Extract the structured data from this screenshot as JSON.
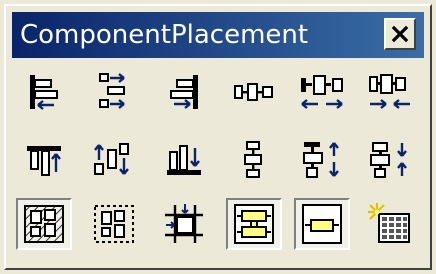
{
  "window": {
    "title": "ComponentPlacement"
  },
  "toolbar": {
    "close_icon": "close-icon",
    "rows": [
      [
        {
          "name": "align-left-icon"
        },
        {
          "name": "align-horizontal-center-icon"
        },
        {
          "name": "align-right-icon"
        },
        {
          "name": "space-equally-horizontal-icon"
        },
        {
          "name": "increase-horizontal-spacing-icon"
        },
        {
          "name": "decrease-horizontal-spacing-icon"
        }
      ],
      [
        {
          "name": "align-top-icon"
        },
        {
          "name": "align-vertical-center-icon"
        },
        {
          "name": "align-bottom-icon"
        },
        {
          "name": "space-equally-vertical-icon"
        },
        {
          "name": "increase-vertical-spacing-icon"
        },
        {
          "name": "decrease-vertical-spacing-icon"
        }
      ],
      [
        {
          "name": "arrange-within-area-icon"
        },
        {
          "name": "arrange-within-rectangle-icon"
        },
        {
          "name": "move-to-grid-icon"
        },
        {
          "name": "toggle-snap-icon"
        },
        {
          "name": "toggle-single-icon"
        },
        {
          "name": "grid-spark-icon"
        }
      ]
    ]
  }
}
